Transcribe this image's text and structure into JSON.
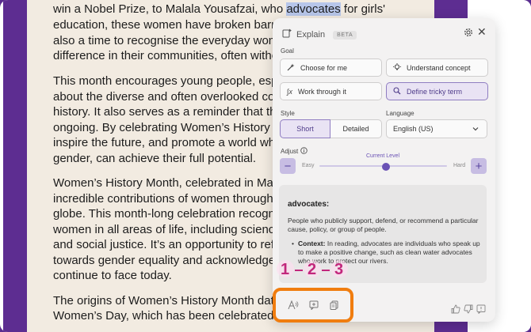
{
  "article": {
    "line1_before": "win a Nobel Prize, to Malala Yousafzai, who ",
    "highlight": "advocates",
    "line1_after": " for girls'",
    "line2": "education, these women have broken barrie",
    "line3": "also a time to recognise the everyday wome",
    "line4": "difference in their communities, often without",
    "line5": "This month encourages young people, espe",
    "line6": "about the diverse and often overlooked cont",
    "line7": "history. It also serves as a reminder that the",
    "line8": "ongoing. By celebrating Women’s History Mo",
    "line9": "inspire the future, and promote a world wher",
    "line10": "gender, can achieve their full potential.",
    "line11": "Women’s History Month, celebrated in March",
    "line12": "incredible contributions of women throughou",
    "line13": "globe. This month-long celebration recognise",
    "line14": "women in all areas of life, including science,",
    "line15": "and social justice. It’s an opportunity to refle",
    "line16": "towards gender equality and acknowledge th",
    "line17": "continue to face today.",
    "line18": "The origins of Women’s History Month date",
    "line19": "Women’s Day, which has been celebrated o"
  },
  "panel": {
    "title": "Explain",
    "badge": "BETA",
    "goal_label": "Goal",
    "goal_options": [
      "Choose for me",
      "Understand concept",
      "Work through it",
      "Define tricky term"
    ],
    "style_label": "Style",
    "style_options": [
      "Short",
      "Detailed"
    ],
    "language_label": "Language",
    "language_value": "English (US)",
    "adjust_label": "Adjust",
    "easy": "Easy",
    "hard": "Hard",
    "current_level": "Current Level",
    "slider_level": 0.52,
    "definition": {
      "term": "advocates:",
      "meaning": "People who publicly support, defend, or recommend a particular cause, policy, or group of people.",
      "context_label": "Context:",
      "context_text": "In reading, advocates are individuals who speak up to make a positive change, such as clean water advocates who work to protect our rivers."
    },
    "steps": [
      "1",
      "2",
      "3"
    ]
  },
  "colors": {
    "accent": "#6a52b5",
    "highlight": "#f07d0f",
    "step_marker": "#c2277c",
    "sidebar_purple": "#5d2d91"
  },
  "icons": [
    "explain-icon",
    "gear-icon",
    "close-icon",
    "wand-icon",
    "bulb-icon",
    "function-icon",
    "search-icon",
    "chevron-down-icon",
    "info-icon",
    "minus-icon",
    "plus-icon",
    "text-size-icon",
    "comment-icon",
    "copy-icon",
    "thumbs-up-icon",
    "thumbs-down-icon",
    "report-icon"
  ]
}
